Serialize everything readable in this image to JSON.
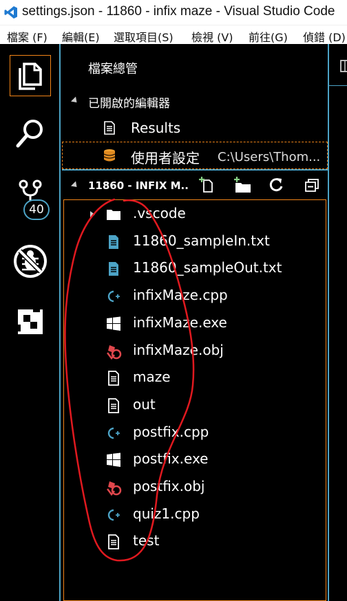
{
  "window": {
    "title": "settings.json - 11860 - infix maze - Visual Studio Code"
  },
  "menubar": [
    "檔案 (F)",
    "編輯(E)",
    "選取項目(S)",
    "檢視 (V)",
    "前往(G)",
    "偵錯 (D)"
  ],
  "activity": {
    "scm_badge": "40"
  },
  "sidebar": {
    "title": "檔案總管",
    "open_editors": {
      "header": "已開啟的編輯器",
      "items": [
        {
          "label": "Results",
          "path": ""
        },
        {
          "label": "使用者設定",
          "path": "C:\\Users\\Thom..."
        }
      ]
    },
    "folder": {
      "header": "11860 - INFIX M..",
      "files": [
        {
          "name": ".vscode",
          "icon": "folder-icon"
        },
        {
          "name": "11860_sampleIn.txt",
          "icon": "text-file-icon"
        },
        {
          "name": "11860_sampleOut.txt",
          "icon": "text-file-icon"
        },
        {
          "name": "infixMaze.cpp",
          "icon": "cpp-file-icon"
        },
        {
          "name": "infixMaze.exe",
          "icon": "windows-exe-icon"
        },
        {
          "name": "infixMaze.obj",
          "icon": "obj-file-icon"
        },
        {
          "name": "maze",
          "icon": "plain-file-icon"
        },
        {
          "name": "out",
          "icon": "plain-file-icon"
        },
        {
          "name": "postfix.cpp",
          "icon": "cpp-file-icon"
        },
        {
          "name": "postfix.exe",
          "icon": "windows-exe-icon"
        },
        {
          "name": "postfix.obj",
          "icon": "obj-file-icon"
        },
        {
          "name": "quiz1.cpp",
          "icon": "cpp-file-icon"
        },
        {
          "name": "test",
          "icon": "plain-file-icon"
        }
      ]
    }
  },
  "colors": {
    "accent_border": "#f38518",
    "contrast_border": "#4ca3c6",
    "annotation": "#e0191f"
  }
}
